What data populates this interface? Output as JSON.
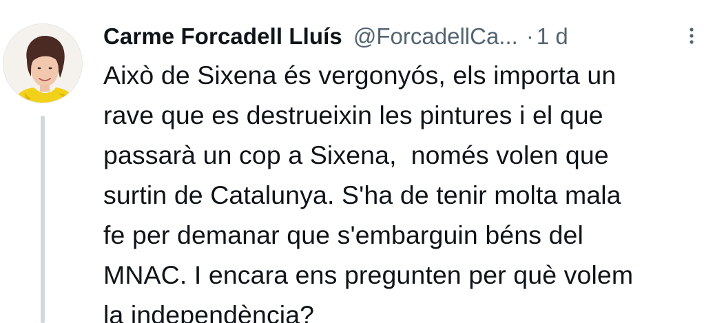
{
  "author": {
    "display_name": "Carme Forcadell Lluís",
    "handle": "@ForcadellCa...",
    "separator": "·",
    "time": "1 d"
  },
  "tweet": {
    "lines": [
      "Això de Sixena és vergonyós, els importa un",
      "rave que es destrueixin les pintures i el que",
      "passarà un cop a Sixena,  només volen que",
      "surtin de Catalunya. S'ha de tenir molta mala",
      "fe per demanar que s'embarguin béns del",
      "MNAC. I encara ens pregunten per què volem",
      "la independència?"
    ]
  },
  "icons": {
    "avatar": "profile-photo",
    "more": "more-vertical-icon"
  },
  "colors": {
    "text": "#0f1419",
    "secondary": "#536471",
    "thread": "#cfd9de"
  }
}
